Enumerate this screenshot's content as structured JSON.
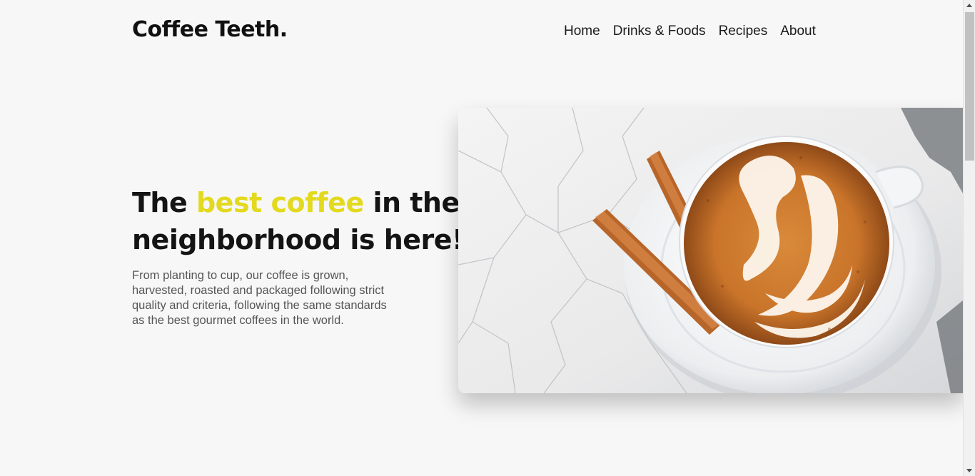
{
  "header": {
    "logo": "Coffee Teeth.",
    "nav": [
      {
        "label": "Home"
      },
      {
        "label": "Drinks & Foods"
      },
      {
        "label": "Recipes"
      },
      {
        "label": "About"
      }
    ]
  },
  "hero": {
    "title_before": "The ",
    "title_accent": "best coffee",
    "title_after": " in the neighborhood is here!",
    "description": "From planting to cup, our coffee is grown, harvested, roasted and packaged following strict quality and criteria, following the same standards as the best gourmet coffees in the world.",
    "image_subject": "latte-art-coffee-cup-with-cinnamon-sticks"
  },
  "colors": {
    "accent": "#e3d91e",
    "background": "#f7f7f7",
    "text": "#141414",
    "muted_text": "#555555"
  }
}
